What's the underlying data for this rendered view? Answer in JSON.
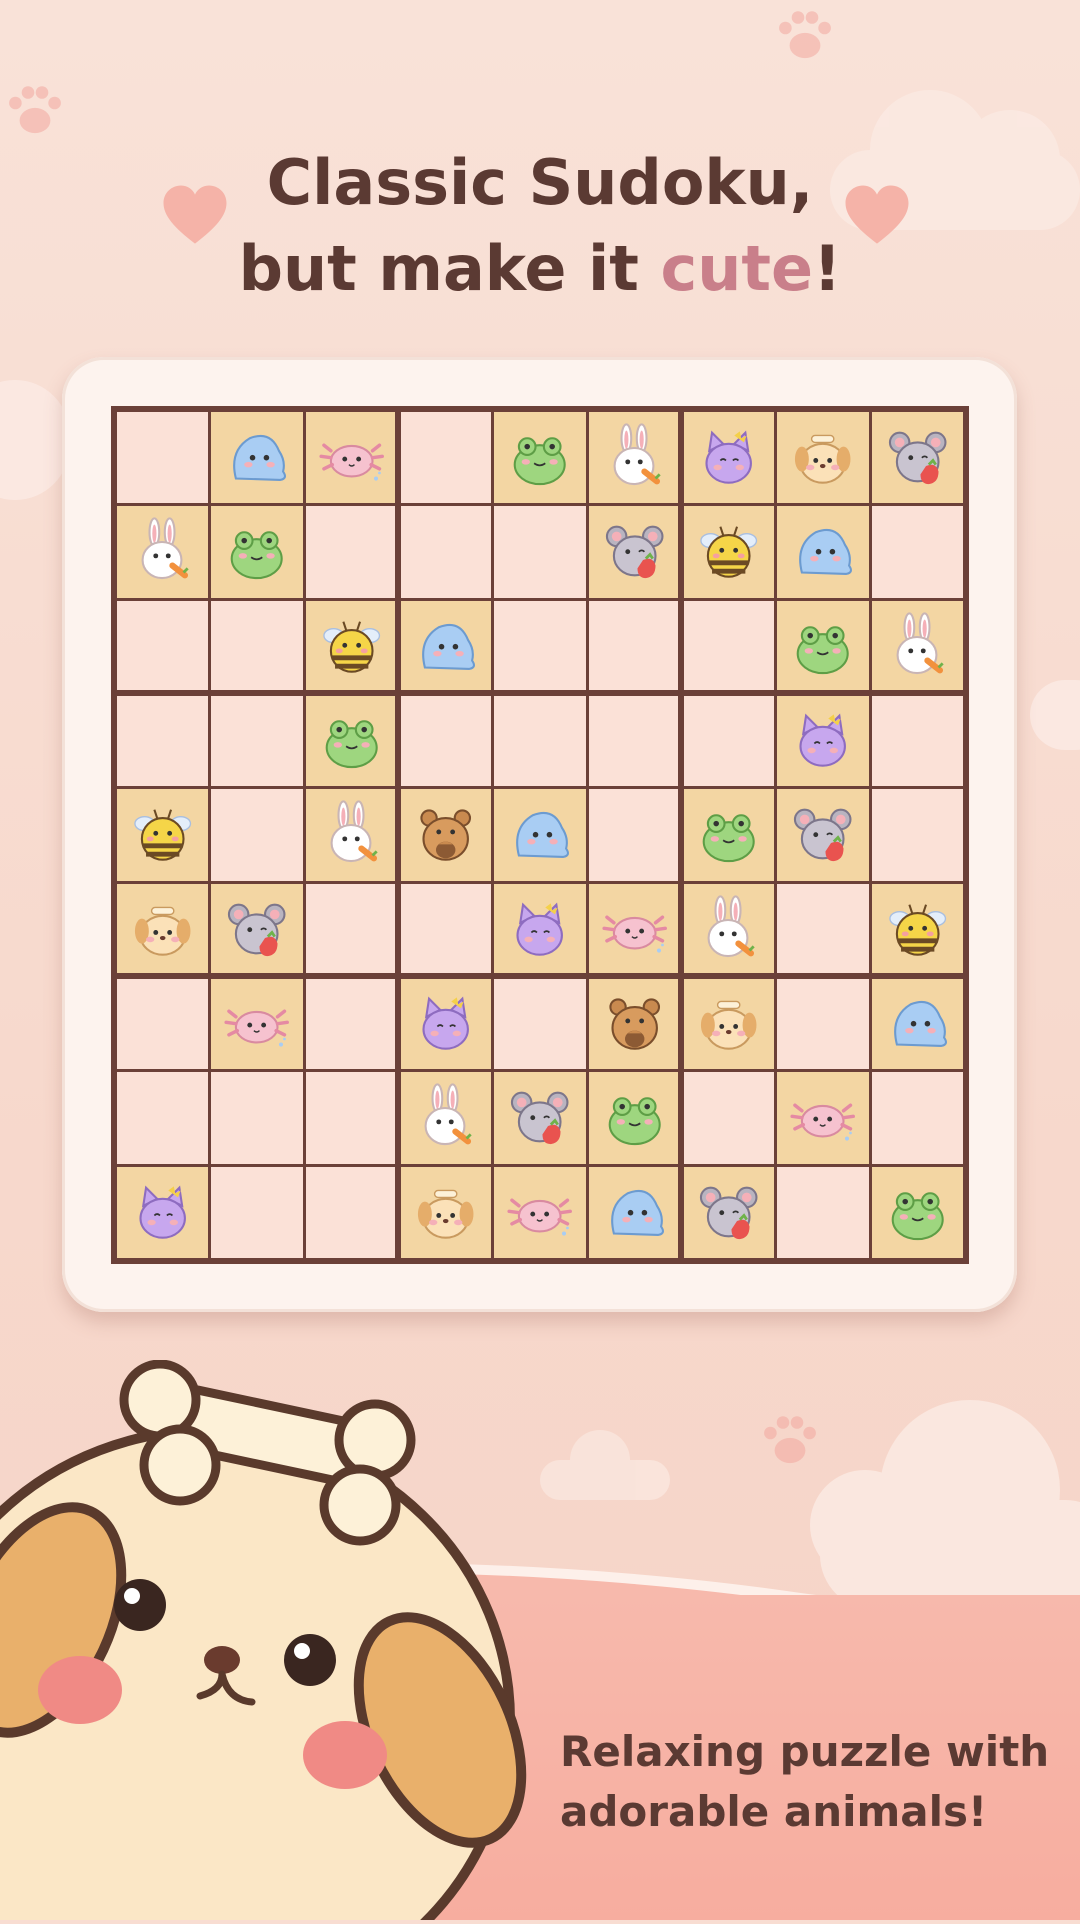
{
  "headline": {
    "line1": "Classic Sudoku,",
    "line2_prefix": "but make it ",
    "line2_accent": "cute",
    "line2_suffix": "!"
  },
  "tagline": {
    "line1": "Relaxing puzzle with",
    "line2": "adorable animals!"
  },
  "colors": {
    "background": "#f8ddd2",
    "title_text": "#5b3a33",
    "accent": "#c97f8a",
    "grid_border": "#6b4038",
    "cell_empty": "#fbe1d7",
    "cell_filled": "#f3d6a3",
    "card": "#fdf3ee"
  },
  "animal_icons": [
    "blob-icon",
    "axolotl-icon",
    "frog-icon",
    "bunny-icon",
    "cat-icon",
    "puppy-icon",
    "mouse-icon",
    "bee-icon",
    "bear-icon"
  ],
  "board": [
    [
      "",
      "blob",
      "axolotl",
      "",
      "frog",
      "bunny",
      "cat",
      "puppy",
      "mouse"
    ],
    [
      "bunny",
      "frog",
      "",
      "",
      "",
      "mouse",
      "bee",
      "blob",
      ""
    ],
    [
      "",
      "",
      "bee",
      "blob",
      "",
      "",
      "",
      "frog",
      "bunny"
    ],
    [
      "",
      "",
      "frog",
      "",
      "",
      "",
      "",
      "cat",
      ""
    ],
    [
      "bee",
      "",
      "bunny",
      "bear",
      "blob",
      "",
      "frog",
      "mouse",
      ""
    ],
    [
      "puppy",
      "mouse",
      "",
      "",
      "cat",
      "axolotl",
      "bunny",
      "",
      "bee"
    ],
    [
      "",
      "axolotl",
      "",
      "cat",
      "",
      "bear",
      "puppy",
      "",
      "blob"
    ],
    [
      "",
      "",
      "",
      "bunny",
      "mouse",
      "frog",
      "",
      "axolotl",
      ""
    ],
    [
      "cat",
      "",
      "",
      "puppy",
      "axolotl",
      "blob",
      "mouse",
      "",
      "frog"
    ]
  ]
}
